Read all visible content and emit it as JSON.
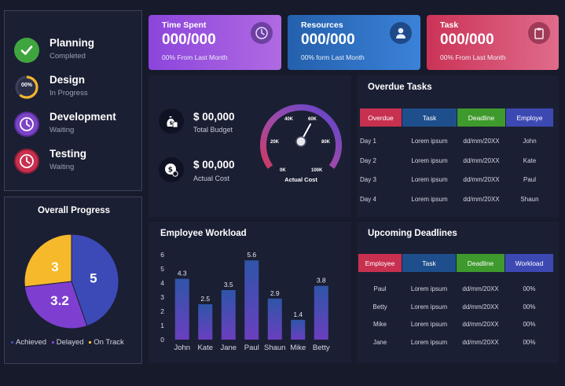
{
  "phases": [
    {
      "name": "Planning",
      "status": "Completed",
      "icon": "check-icon",
      "color": "#3fa63f"
    },
    {
      "name": "Design",
      "status": "In Progress",
      "badge": "00%",
      "icon": "progress-ring-icon",
      "color": "#f2b62e"
    },
    {
      "name": "Development",
      "status": "Waiting",
      "icon": "clock-icon",
      "color": "#7c44c6"
    },
    {
      "name": "Testing",
      "status": "Waiting",
      "icon": "clock-icon",
      "color": "#c8304f"
    }
  ],
  "overall_progress": {
    "title": "Overall Progress",
    "legend": [
      "Achieved",
      "Delayed",
      "On Track"
    ]
  },
  "cards": [
    {
      "title": "Time Spent",
      "value": "000/000",
      "note": "00% From Last Month",
      "icon": "clock-icon"
    },
    {
      "title": "Resources",
      "value": "000/000",
      "note": "00% form Last Month",
      "icon": "user-icon"
    },
    {
      "title": "Task",
      "value": "000/000",
      "note": "00% From Last Month",
      "icon": "clipboard-icon"
    }
  ],
  "budget": {
    "total_value": "$ 00,000",
    "total_label": "Total Budget",
    "actual_value": "$ 00,000",
    "actual_label": "Actual Cost",
    "gauge_label": "Actual Cost",
    "gauge_ticks": [
      "0K",
      "20K",
      "40K",
      "60K",
      "80K",
      "100K"
    ]
  },
  "overdue": {
    "title": "Overdue Tasks",
    "headers": [
      "Overdue",
      "Task",
      "Deadline",
      "Employe"
    ],
    "rows": [
      [
        "Day 1",
        "Lorem ipsum",
        "dd/mm/20XX",
        "John"
      ],
      [
        "Day 2",
        "Lorem ipsum",
        "dd/mm/20XX",
        "Kate"
      ],
      [
        "Day 3",
        "Lorem ipsum",
        "dd/mm/20XX",
        "Paul"
      ],
      [
        "Day 4",
        "Lorem ipsum",
        "dd/mm/20XX",
        "Shaun"
      ]
    ]
  },
  "workload": {
    "title": "Employee Workload"
  },
  "upcoming": {
    "title": "Upcoming Deadlines",
    "headers": [
      "Employee",
      "Task",
      "Deadline",
      "Workload"
    ],
    "rows": [
      [
        "Paul",
        "Lorem ipsum",
        "dd/mm/20XX",
        "00%"
      ],
      [
        "Betty",
        "Lorem ipsum",
        "dd/mm/20XX",
        "00%"
      ],
      [
        "Mike",
        "Lorem ipsum",
        "dd/mm/20XX",
        "00%"
      ],
      [
        "Jane",
        "Lorem ipsum",
        "dd/mm/20XX",
        "00%"
      ]
    ]
  },
  "colors": {
    "background": "#161a2b",
    "panel": "#1b1f33",
    "red": "#c8304f",
    "blue": "#1e4f8c",
    "green": "#3e9a2c",
    "indigo": "#3d49b3",
    "bar": "#2f55a8",
    "pie_blue": "#3c4ab8",
    "pie_purple": "#7e3fd0",
    "pie_yellow": "#f5b92b"
  },
  "chart_data": [
    {
      "type": "pie",
      "title": "Overall Progress",
      "categories": [
        "Achieved",
        "Delayed",
        "On Track"
      ],
      "values": [
        5,
        3.2,
        3
      ],
      "labels": [
        "5",
        "3.2",
        "3"
      ]
    },
    {
      "type": "bar",
      "title": "Employee Workload",
      "categories": [
        "John",
        "Kate",
        "Jane",
        "Paul",
        "Shaun",
        "Mike",
        "Betty"
      ],
      "values": [
        4.3,
        2.5,
        3.5,
        5.6,
        2.9,
        1.4,
        3.8
      ],
      "ylim": [
        0,
        6
      ],
      "yticks": [
        "0",
        "1",
        "2",
        "3",
        "4",
        "5",
        "6"
      ],
      "grid": false
    }
  ]
}
